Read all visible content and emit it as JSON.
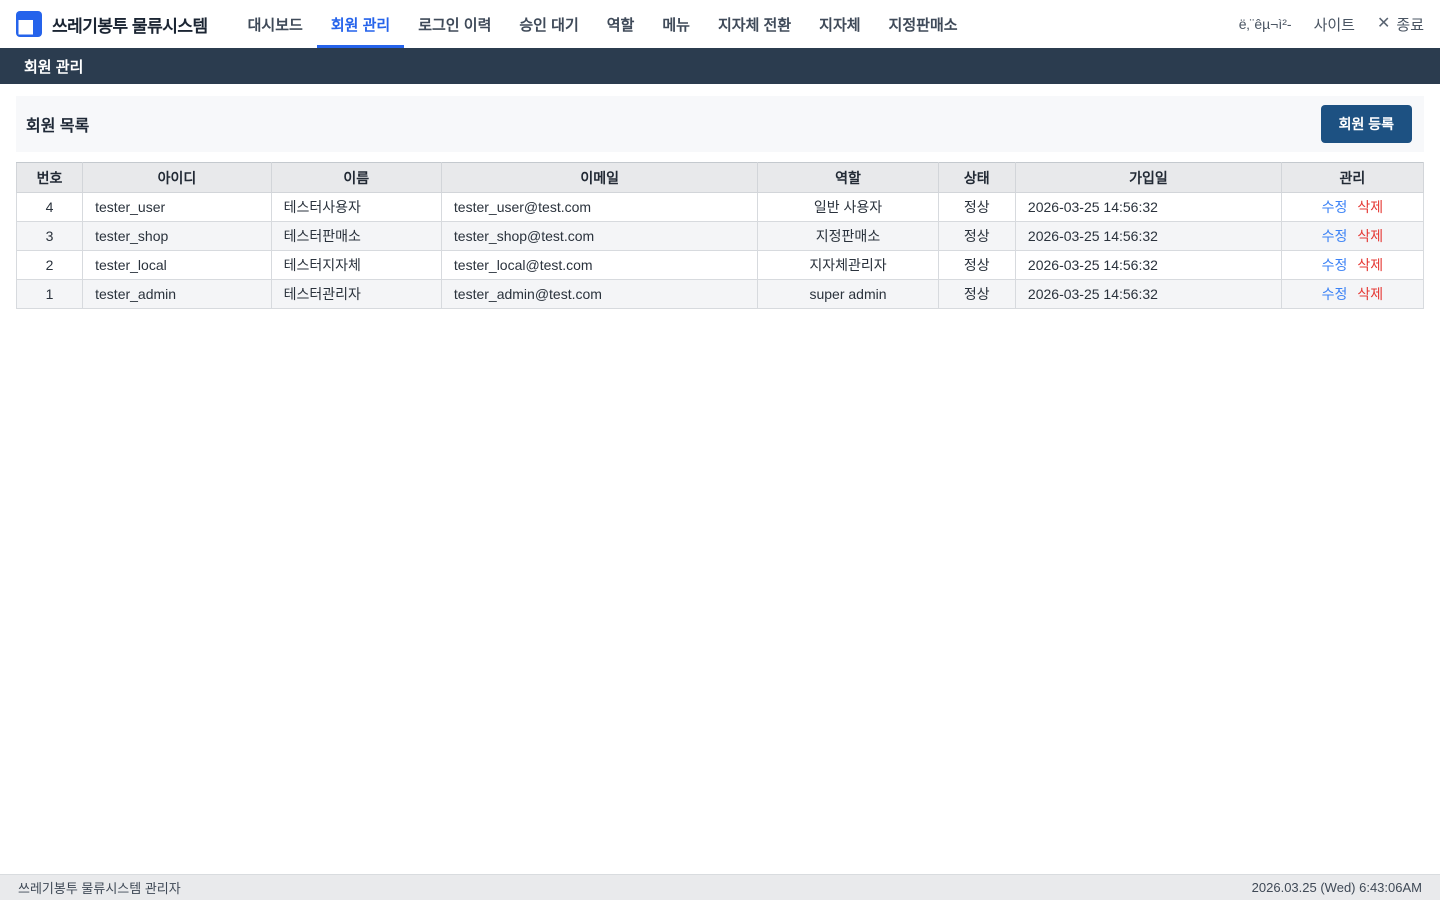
{
  "app": {
    "title": "쓰레기봉투 물류시스템",
    "logo_icon": "overlapping-squares-logo"
  },
  "nav": {
    "items": [
      {
        "label": "대시보드",
        "active": false
      },
      {
        "label": "회원 관리",
        "active": true
      },
      {
        "label": "로그인 이력",
        "active": false
      },
      {
        "label": "승인 대기",
        "active": false
      },
      {
        "label": "역할",
        "active": false
      },
      {
        "label": "메뉴",
        "active": false
      },
      {
        "label": "지자체 전환",
        "active": false
      },
      {
        "label": "지자체",
        "active": false
      },
      {
        "label": "지정판매소",
        "active": false
      }
    ],
    "right": {
      "org_label": "ë‚¨êµ¬ì²-",
      "site_link": "사이트",
      "close_icon": "✕",
      "logout_label": "종료"
    }
  },
  "page_header": {
    "title": "회원 관리"
  },
  "section": {
    "title": "회원 목록",
    "register_button": "회원 등록"
  },
  "table": {
    "columns": [
      "번호",
      "아이디",
      "이름",
      "이메일",
      "역할",
      "상태",
      "가입일",
      "관리"
    ],
    "actions": {
      "edit": "수정",
      "delete": "삭제"
    },
    "rows": [
      {
        "no": "4",
        "id": "tester_user",
        "name": "테스터사용자",
        "email": "tester_user@test.com",
        "role": "일반 사용자",
        "status": "정상",
        "joined": "2026-03-25 14:56:32"
      },
      {
        "no": "3",
        "id": "tester_shop",
        "name": "테스터판매소",
        "email": "tester_shop@test.com",
        "role": "지정판매소",
        "status": "정상",
        "joined": "2026-03-25 14:56:32"
      },
      {
        "no": "2",
        "id": "tester_local",
        "name": "테스터지자체",
        "email": "tester_local@test.com",
        "role": "지자체관리자",
        "status": "정상",
        "joined": "2026-03-25 14:56:32"
      },
      {
        "no": "1",
        "id": "tester_admin",
        "name": "테스터관리자",
        "email": "tester_admin@test.com",
        "role": "super admin",
        "status": "정상",
        "joined": "2026-03-25 14:56:32"
      }
    ]
  },
  "footer": {
    "left": "쓰레기봉투 물류시스템 관리자",
    "right": "2026.03.25 (Wed) 6:43:06AM"
  },
  "colors": {
    "accent_blue": "#2563eb",
    "button_navy": "#1d5182",
    "pagebar_navy": "#2b3c4f",
    "delete_red": "#e53935",
    "edit_blue": "#3b82f6"
  }
}
